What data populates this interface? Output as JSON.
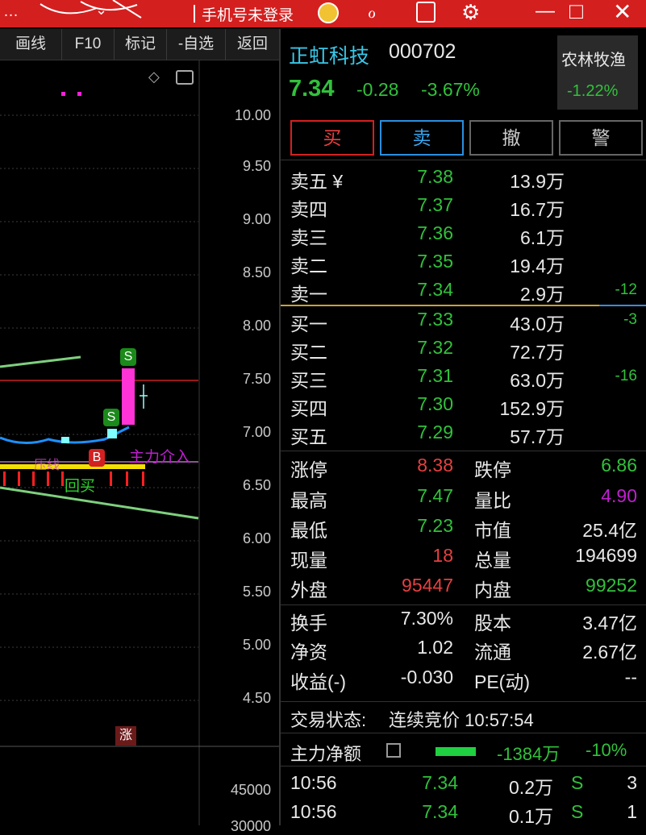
{
  "topbar": {
    "left_text": "…",
    "login_text": "手机号未登录",
    "minimize": "—",
    "restore": "□",
    "close": "✕"
  },
  "toolbar": {
    "draw": "画线",
    "f10": "F10",
    "mark": "标记",
    "unwatch": "-自选",
    "back": "返回"
  },
  "chart": {
    "price_ticks": [
      "10.00",
      "9.50",
      "9.00",
      "8.50",
      "8.00",
      "7.50",
      "7.00",
      "6.50",
      "6.00",
      "5.50",
      "5.00",
      "4.50"
    ],
    "volume_tick": "45000",
    "volume_tick2": "30000",
    "annotations": {
      "main_force": "主力介入",
      "pullback": "回买",
      "b_label": "B",
      "s_label": "S",
      "limit_up": "涨",
      "wave_text": "压线"
    }
  },
  "stock": {
    "name": "正虹科技",
    "code": "000702",
    "price": "7.34",
    "change": "-0.28",
    "change_pct": "-3.67%",
    "sector": "农林牧渔",
    "sector_pct": "-1.22%"
  },
  "actions": {
    "buy": "买",
    "sell": "卖",
    "cancel": "撤",
    "alert": "警"
  },
  "order_book": {
    "asks": [
      {
        "label": "卖五 ¥",
        "price": "7.38",
        "vol": "13.9万",
        "delta": ""
      },
      {
        "label": "卖四",
        "price": "7.37",
        "vol": "16.7万",
        "delta": ""
      },
      {
        "label": "卖三",
        "price": "7.36",
        "vol": "6.1万",
        "delta": ""
      },
      {
        "label": "卖二",
        "price": "7.35",
        "vol": "19.4万",
        "delta": ""
      },
      {
        "label": "卖一",
        "price": "7.34",
        "vol": "2.9万",
        "delta": "-12"
      }
    ],
    "bids": [
      {
        "label": "买一",
        "price": "7.33",
        "vol": "43.0万",
        "delta": "-3"
      },
      {
        "label": "买二",
        "price": "7.32",
        "vol": "72.7万",
        "delta": ""
      },
      {
        "label": "买三",
        "price": "7.31",
        "vol": "63.0万",
        "delta": "-16"
      },
      {
        "label": "买四",
        "price": "7.30",
        "vol": "152.9万",
        "delta": ""
      },
      {
        "label": "买五",
        "price": "7.29",
        "vol": "57.7万",
        "delta": ""
      }
    ]
  },
  "stats": {
    "limit_up_label": "涨停",
    "limit_up": "8.38",
    "limit_down_label": "跌停",
    "limit_down": "6.86",
    "high_label": "最高",
    "high": "7.47",
    "vol_ratio_label": "量比",
    "vol_ratio": "4.90",
    "low_label": "最低",
    "low": "7.23",
    "mkt_cap_label": "市值",
    "mkt_cap": "25.4亿",
    "cur_vol_label": "现量",
    "cur_vol": "18",
    "total_vol_label": "总量",
    "total_vol": "194699",
    "outer_label": "外盘",
    "outer": "95447",
    "inner_label": "内盘",
    "inner": "99252",
    "turnover_label": "换手",
    "turnover": "7.30%",
    "share_cap_label": "股本",
    "share_cap": "3.47亿",
    "nav_label": "净资",
    "nav": "1.02",
    "float_label": "流通",
    "float": "2.67亿",
    "eps_label": "收益(-)",
    "eps": "-0.030",
    "pe_label": "PE(动)",
    "pe": "--"
  },
  "trade_status": {
    "label": "交易状态:",
    "value": "连续竞价 10:57:54"
  },
  "main_force": {
    "label": "主力净额",
    "value": "-1384万",
    "pct": "-10%"
  },
  "ticks": [
    {
      "time": "10:56",
      "price": "7.34",
      "vol": "0.2万",
      "side": "S",
      "count": "3"
    },
    {
      "time": "10:56",
      "price": "7.34",
      "vol": "0.1万",
      "side": "S",
      "count": "1"
    }
  ],
  "colors": {
    "up": "#e64040",
    "down": "#31c13b",
    "accent": "#d41f1f",
    "purple": "#c01fd0"
  }
}
